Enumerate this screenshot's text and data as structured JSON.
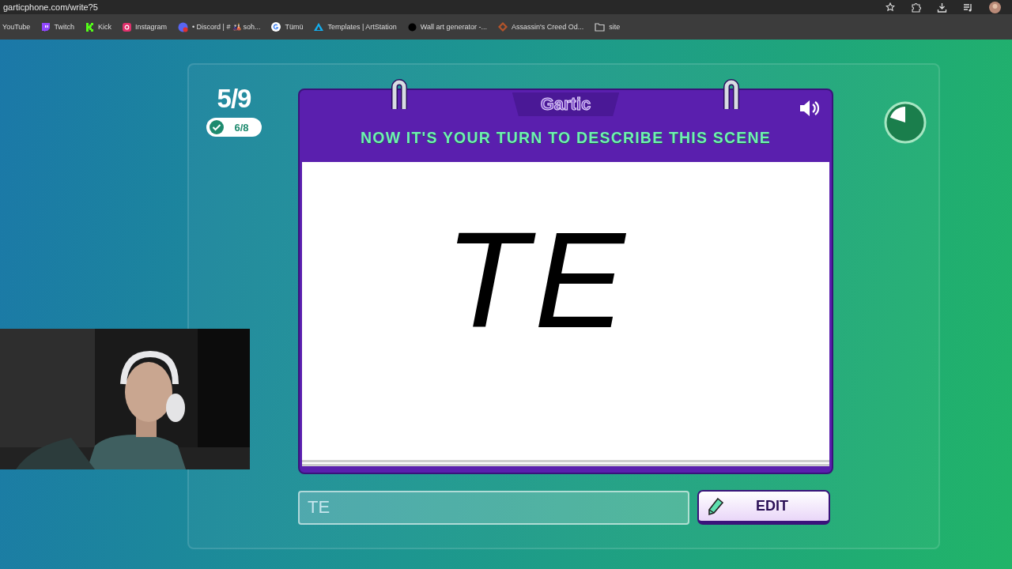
{
  "browser": {
    "url": "garticphone.com/write?5",
    "bookmarks": [
      {
        "label": "YouTube",
        "kind": "plain"
      },
      {
        "label": "Twitch",
        "kind": "twitch"
      },
      {
        "label": "Kick",
        "kind": "kick"
      },
      {
        "label": "Instagram",
        "kind": "instagram"
      },
      {
        "label": "• Discord | # 🎎 soh...",
        "kind": "discord"
      },
      {
        "label": "Tümü",
        "kind": "google"
      },
      {
        "label": "Templates | ArtStation",
        "kind": "artstation"
      },
      {
        "label": "Wall art generator -...",
        "kind": "dot"
      },
      {
        "label": "Assassin's Creed Od...",
        "kind": "game"
      },
      {
        "label": "site",
        "kind": "folder"
      }
    ]
  },
  "game": {
    "round": "5/9",
    "done_count": "6/8",
    "logo": "Gartic",
    "prompt": "NOW IT'S YOUR TURN TO DESCRIBE THIS SCENE",
    "drawing_text": "TE",
    "answer": {
      "value": "TE"
    },
    "button": "EDIT",
    "timer": {
      "level": 0.2
    }
  }
}
